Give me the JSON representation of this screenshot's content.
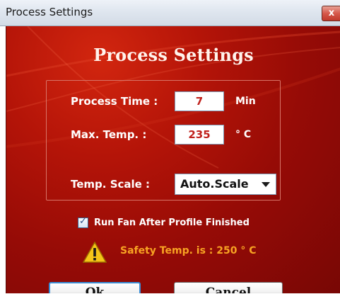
{
  "window": {
    "title": "Process Settings",
    "close_glyph": "x"
  },
  "dialog": {
    "heading": "Process Settings"
  },
  "fields": {
    "process_time": {
      "label": "Process Time :",
      "value": "7",
      "unit": "Min"
    },
    "max_temp": {
      "label": "Max. Temp. :",
      "value": "235",
      "unit": "° C"
    },
    "temp_scale": {
      "label": "Temp. Scale :",
      "selected": "Auto.Scale"
    }
  },
  "run_fan": {
    "label": "Run Fan After Profile Finished",
    "checked": true
  },
  "warning": {
    "text": "Safety Temp. is : 250 ° C",
    "icon": "warning-icon",
    "color": "#f8a323"
  },
  "buttons": {
    "ok": "Ok",
    "cancel": "Cancel"
  },
  "colors": {
    "background": "#b41408",
    "accent": "#3b8fd8",
    "value_text": "#c0211c"
  }
}
